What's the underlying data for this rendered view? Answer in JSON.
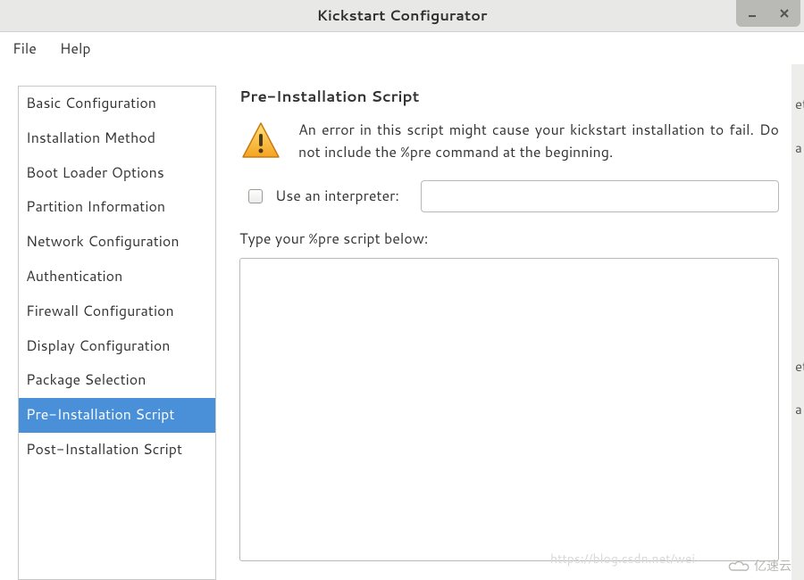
{
  "window": {
    "title": "Kickstart Configurator"
  },
  "menubar": {
    "file": "File",
    "help": "Help"
  },
  "sidebar": {
    "items": [
      {
        "label": "Basic Configuration"
      },
      {
        "label": "Installation Method"
      },
      {
        "label": "Boot Loader Options"
      },
      {
        "label": "Partition Information"
      },
      {
        "label": "Network Configuration"
      },
      {
        "label": "Authentication"
      },
      {
        "label": "Firewall Configuration"
      },
      {
        "label": "Display Configuration"
      },
      {
        "label": "Package Selection"
      },
      {
        "label": "Pre-Installation Script"
      },
      {
        "label": "Post-Installation Script"
      }
    ],
    "selected_index": 9
  },
  "main": {
    "heading": "Pre-Installation Script",
    "warning": "An error in this script might cause your kickstart installation to fail. Do not include the %pre command at the beginning.",
    "use_interpreter_label": "Use an interpreter:",
    "use_interpreter_checked": false,
    "interpreter_value": "",
    "script_label": "Type your %pre script below:",
    "script_value": ""
  },
  "background_fragments": {
    "f1": "et",
    "f2": "a",
    "f3": "et",
    "f4": "a"
  },
  "watermark": {
    "url": "https://blog.csdn.net/wei",
    "logo_text": "亿速云"
  }
}
